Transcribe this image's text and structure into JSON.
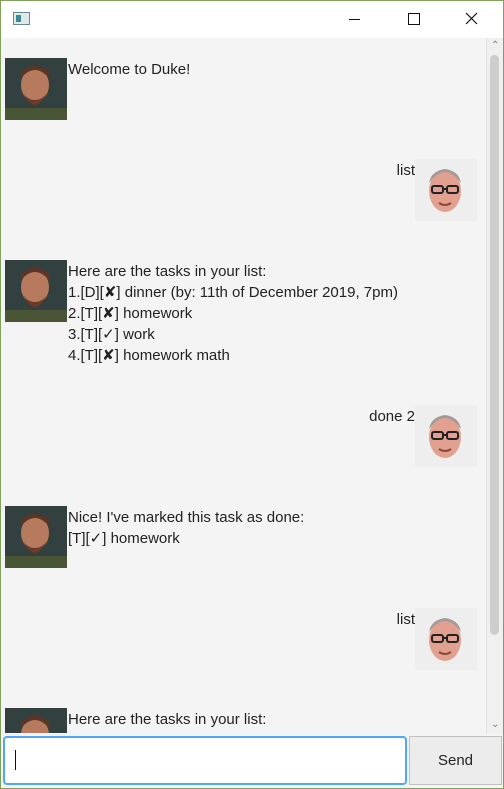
{
  "window": {
    "icon": "app-window-icon",
    "controls": {
      "minimize": "minimize-icon",
      "maximize": "maximize-icon",
      "close": "close-icon"
    }
  },
  "messages": [
    {
      "sender": "duke",
      "text": "Welcome to Duke!"
    },
    {
      "sender": "user",
      "text": "list"
    },
    {
      "sender": "duke",
      "text": "Here are the tasks in your list:\n1.[D][✘] dinner (by: 11th of December 2019, 7pm)\n2.[T][✘] homework\n3.[T][✓] work\n4.[T][✘] homework math"
    },
    {
      "sender": "user",
      "text": "done 2"
    },
    {
      "sender": "duke",
      "text": "Nice! I've marked this task as done:\n[T][✓] homework"
    },
    {
      "sender": "user",
      "text": "list"
    },
    {
      "sender": "duke",
      "text": "Here are the tasks in your list:"
    }
  ],
  "input": {
    "value": "",
    "placeholder": ""
  },
  "send_button": {
    "label": "Send"
  }
}
